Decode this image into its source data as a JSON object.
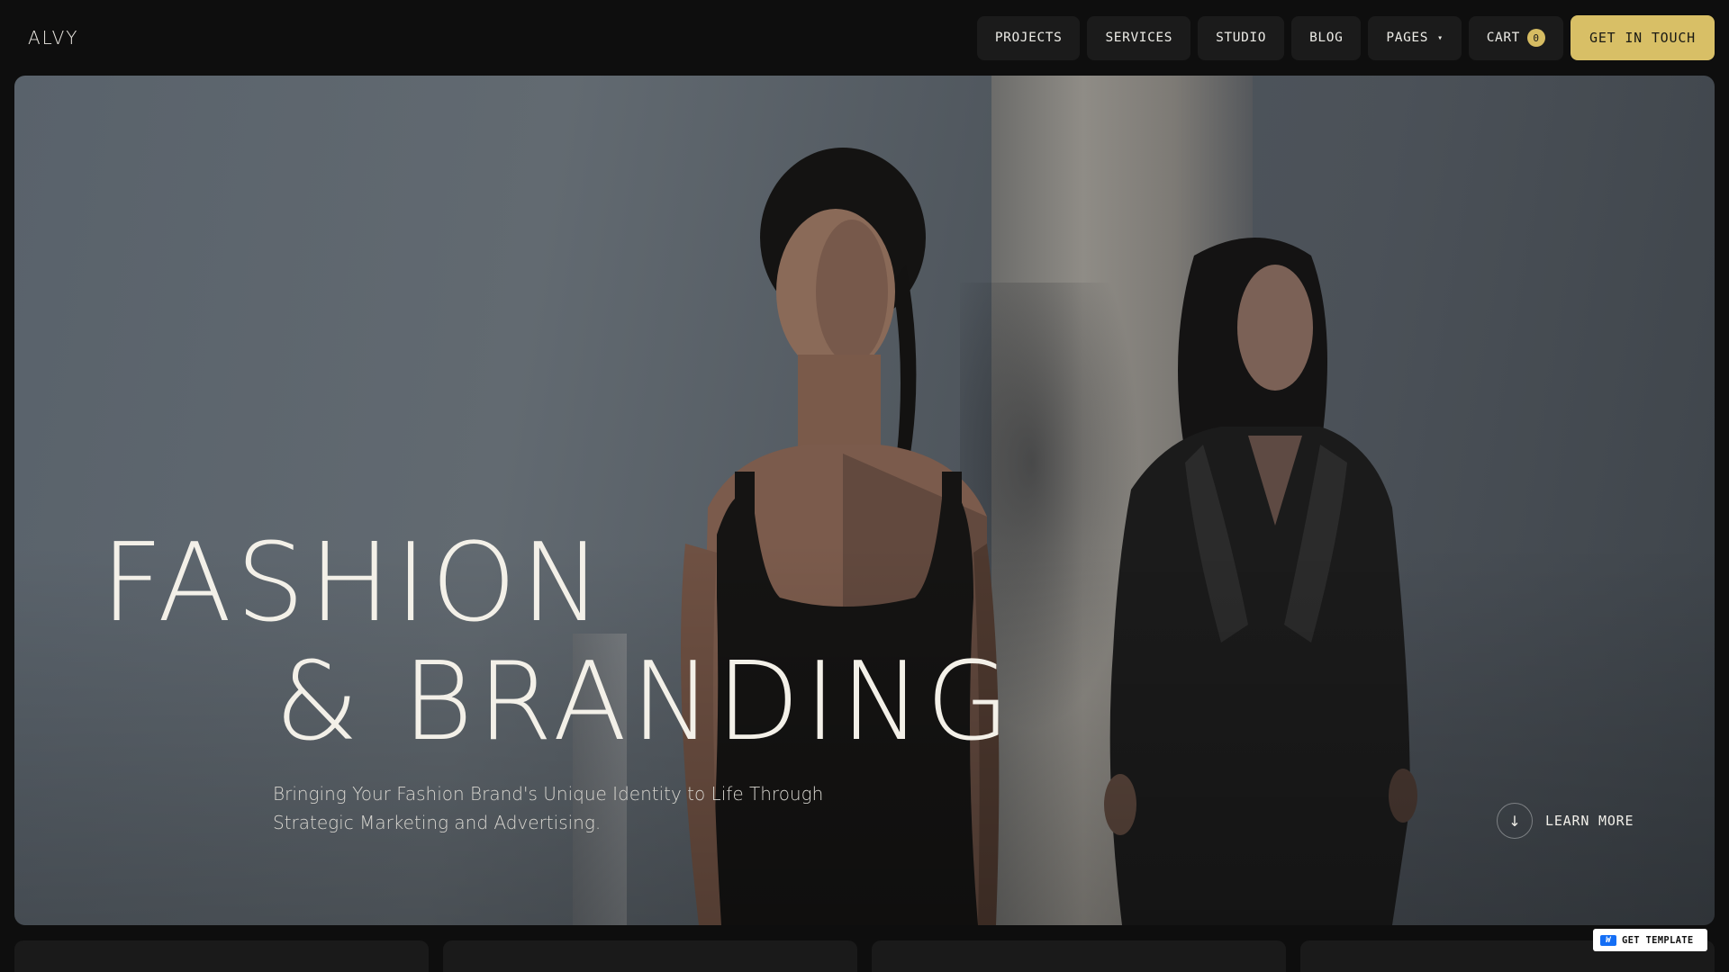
{
  "brand": {
    "logo": "ALVY"
  },
  "nav": {
    "items": [
      {
        "label": "PROJECTS"
      },
      {
        "label": "SERVICES"
      },
      {
        "label": "STUDIO"
      },
      {
        "label": "BLOG"
      },
      {
        "label": "PAGES"
      }
    ],
    "cart_label": "CART",
    "cart_count": "0",
    "cta_label": "GET IN TOUCH"
  },
  "hero": {
    "headline_line1": "FASHION",
    "headline_line2": "& BRANDING",
    "subtitle": "Bringing Your Fashion Brand's Unique Identity to Life Through Strategic Marketing and Advertising.",
    "learn_more_label": "LEARN MORE",
    "learn_more_icon": "arrow-down-icon"
  },
  "badge": {
    "label": "GET TEMPLATE",
    "icon": "webflow-icon"
  },
  "colors": {
    "accent": "#d8bf66",
    "background": "#0e0e0e",
    "nav_pill": "#1b1b1b"
  }
}
